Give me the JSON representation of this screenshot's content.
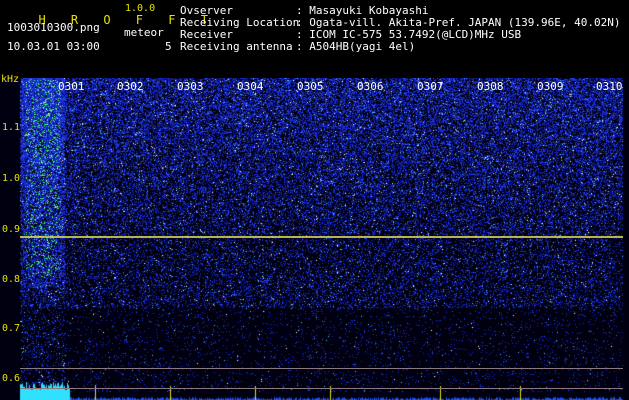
{
  "header": {
    "app_title": "H R O F F T",
    "version": "1.0.0",
    "filename": "1003010300.png",
    "datetime": "10.03.01 03:00",
    "meteor_label": "meteor",
    "meteor_count": "5"
  },
  "info": {
    "rows": [
      {
        "label": "Ovserver",
        "value": ": Masayuki Kobayashi"
      },
      {
        "label": "Receiving Location",
        "value": ": Ogata-vill. Akita-Pref. JAPAN (139.96E, 40.02N)"
      },
      {
        "label": "Receiver",
        "value": ": ICOM IC-575 53.7492(@LCD)MHz USB"
      },
      {
        "label": "Receiving antenna",
        "value": ": A504HB(yagi 4el)"
      }
    ]
  },
  "axis": {
    "unit": "kHz",
    "y_ticks": [
      "1.1",
      "1.0",
      "0.9",
      "0.8",
      "0.7",
      "0.6"
    ],
    "minutes": [
      "0301",
      "0302",
      "0303",
      "0304",
      "0305",
      "0306",
      "0307",
      "0308",
      "0309",
      "0310"
    ]
  },
  "colors": {
    "header_text": "#e7e100",
    "carrier": "#e8d840",
    "noise": "#1a3cff"
  }
}
